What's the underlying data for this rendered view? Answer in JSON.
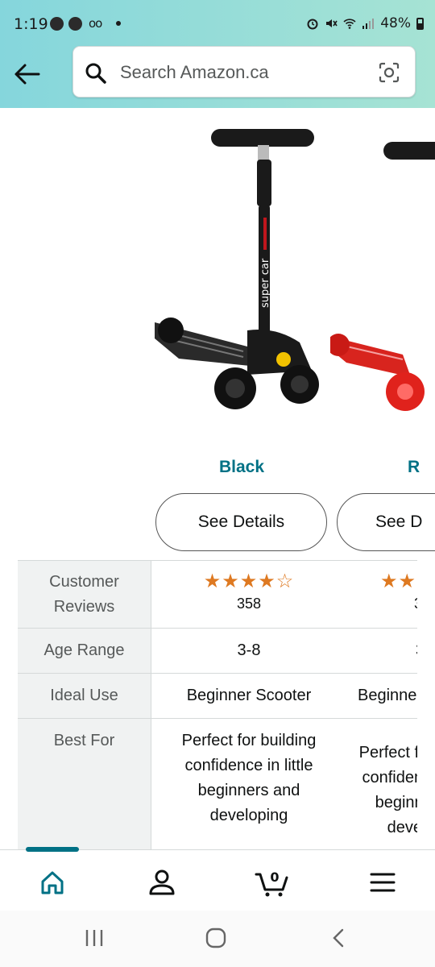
{
  "status_bar": {
    "time": "1:19",
    "battery": "48%"
  },
  "search": {
    "placeholder": "Search Amazon.ca"
  },
  "products": [
    {
      "color": "Black",
      "button": "See Details"
    },
    {
      "color": "R",
      "button": "See D"
    }
  ],
  "comparison": {
    "rows": [
      {
        "label": "Customer Reviews",
        "col1": {
          "stars": "★★★★☆",
          "rating": 4,
          "count": "358"
        },
        "col2": {
          "stars": "★★",
          "count": "3"
        }
      },
      {
        "label": "Age Range",
        "col1": "3-8",
        "col2": "3"
      },
      {
        "label": "Ideal Use",
        "col1": "Beginner Scooter",
        "col2": "Beginne"
      },
      {
        "label": "Best For",
        "col1": "Perfect for building confidence in little beginners and developing",
        "col2": "Perfect for building confidence in little beginners and developing"
      }
    ]
  },
  "bottom_nav": {
    "cart_count": "0",
    "active_tab": "home"
  },
  "colors": {
    "teal": "#007185",
    "star": "#de7921",
    "header_gradient_start": "#85d6dc",
    "header_gradient_end": "#a6e3d4"
  },
  "icons": [
    "back-arrow-icon",
    "search-icon",
    "camera-lens-icon",
    "home-icon",
    "account-icon",
    "cart-icon",
    "menu-icon"
  ]
}
